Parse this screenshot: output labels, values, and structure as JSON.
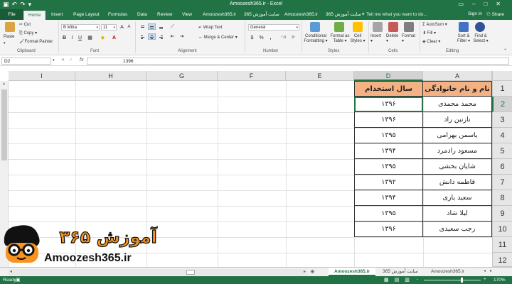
{
  "window": {
    "title": "Amoozesh365.ir - Excel"
  },
  "tabs": [
    "File",
    "Home",
    "Insert",
    "Page Layout",
    "Formulas",
    "Data",
    "Review",
    "View",
    "Amoozesh365.ir",
    "365 سایت آموزش",
    "Amoozesh365.ir",
    "365 سایت آموزش"
  ],
  "tellme": "Tell me what you want to do...",
  "account": {
    "signin": "Sign in",
    "share": "Share"
  },
  "ribbon": {
    "clipboard": {
      "label": "Clipboard",
      "paste": "Paste",
      "cut": "Cut",
      "copy": "Copy",
      "format_painter": "Format Painter"
    },
    "font": {
      "label": "Font",
      "name": "B Mitra",
      "size": "11",
      "bold": "B",
      "italic": "I",
      "underline": "U"
    },
    "alignment": {
      "label": "Alignment",
      "wrap": "Wrap Text",
      "merge": "Merge & Center"
    },
    "number": {
      "label": "Number",
      "format": "General",
      "currency": "$",
      "percent": "%"
    },
    "styles": {
      "label": "Styles",
      "conditional": [
        "Conditional",
        "Formatting"
      ],
      "format_table": [
        "Format as",
        "Table"
      ],
      "cell_styles": [
        "Cell",
        "Styles"
      ]
    },
    "cells": {
      "label": "Cells",
      "insert": "Insert",
      "delete": "Delete",
      "format": "Format"
    },
    "editing": {
      "label": "Editing",
      "autosum": "AutoSum",
      "fill": "Fill",
      "clear": "Clear",
      "sort": [
        "Sort &",
        "Filter"
      ],
      "find": [
        "Find &",
        "Select"
      ]
    }
  },
  "formula_bar": {
    "namebox": "D2",
    "fx": "fx",
    "value": "1396"
  },
  "columns": [
    "I",
    "H",
    "G",
    "F",
    "E",
    "D",
    "A"
  ],
  "rows": [
    "1",
    "2",
    "3",
    "4",
    "5",
    "6",
    "7",
    "8",
    "9",
    "10",
    "11",
    "12"
  ],
  "table": {
    "header": {
      "name": "نام و نام خانوادگی",
      "year": "سال استخدام"
    },
    "rows": [
      {
        "name": "محمد محمدی",
        "year": "۱۳۹۶"
      },
      {
        "name": "نازنین راد",
        "year": "۱۳۹۶"
      },
      {
        "name": "یاسمن بهرامی",
        "year": "۱۳۹۵"
      },
      {
        "name": "مسعود رادمرد",
        "year": "۱۳۹۴"
      },
      {
        "name": "شایان بخشی",
        "year": "۱۳۹۵"
      },
      {
        "name": "فاطمه دانش",
        "year": "۱۳۹۲"
      },
      {
        "name": "سعید یاری",
        "year": "۱۳۹۴"
      },
      {
        "name": "لیلا شاد",
        "year": "۱۳۹۵"
      },
      {
        "name": "رجب سعیدی",
        "year": "۱۳۹۶"
      }
    ]
  },
  "logo": {
    "persian": "آموزش ۳۶۵",
    "latin": "Amoozesh365.ir"
  },
  "sheets": [
    "Amoozesh365.ir",
    "365 سایت آموزش",
    "Amoozesh365.ir"
  ],
  "status": {
    "left": "Ready",
    "zoom": "170%",
    "zoom_minus": "-",
    "zoom_plus": "+"
  },
  "colors": {
    "excel_green": "#217346",
    "header_fill": "#f4b183",
    "logo_orange": "#f7931e"
  }
}
